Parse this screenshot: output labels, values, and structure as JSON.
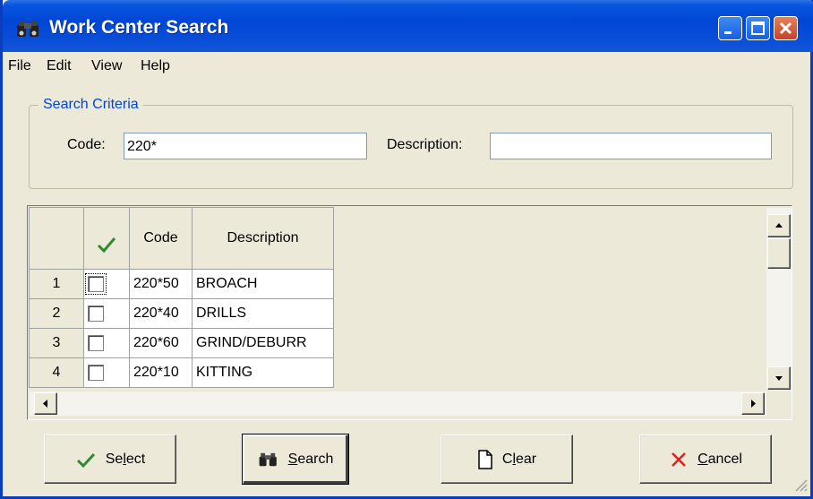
{
  "window": {
    "title": "Work Center Search"
  },
  "menu": [
    "File",
    "Edit",
    "View",
    "Help"
  ],
  "search_criteria": {
    "title": "Search Criteria",
    "code_label": "Code:",
    "code_value": "220*",
    "description_label": "Description:",
    "description_value": ""
  },
  "grid": {
    "columns": [
      "",
      "Code",
      "Description"
    ],
    "rows": [
      {
        "num": "1",
        "checked": false,
        "code": "220*50",
        "description": "BROACH"
      },
      {
        "num": "2",
        "checked": false,
        "code": "220*40",
        "description": "DRILLS"
      },
      {
        "num": "3",
        "checked": false,
        "code": "220*60",
        "description": "GRIND/DEBURR"
      },
      {
        "num": "4",
        "checked": false,
        "code": "220*10",
        "description": "KITTING"
      }
    ]
  },
  "buttons": {
    "select": {
      "pre": "Se",
      "u": "l",
      "post": "ect"
    },
    "search": {
      "pre": "",
      "u": "S",
      "post": "earch"
    },
    "clear": {
      "pre": "C",
      "u": "l",
      "post": "ear"
    },
    "cancel": {
      "pre": "",
      "u": "C",
      "post": "ancel"
    }
  },
  "colors": {
    "title_bar": "#0046d6",
    "accent_text": "#0046d5",
    "check_green": "#2e8b2e",
    "cancel_red": "#e02020"
  }
}
